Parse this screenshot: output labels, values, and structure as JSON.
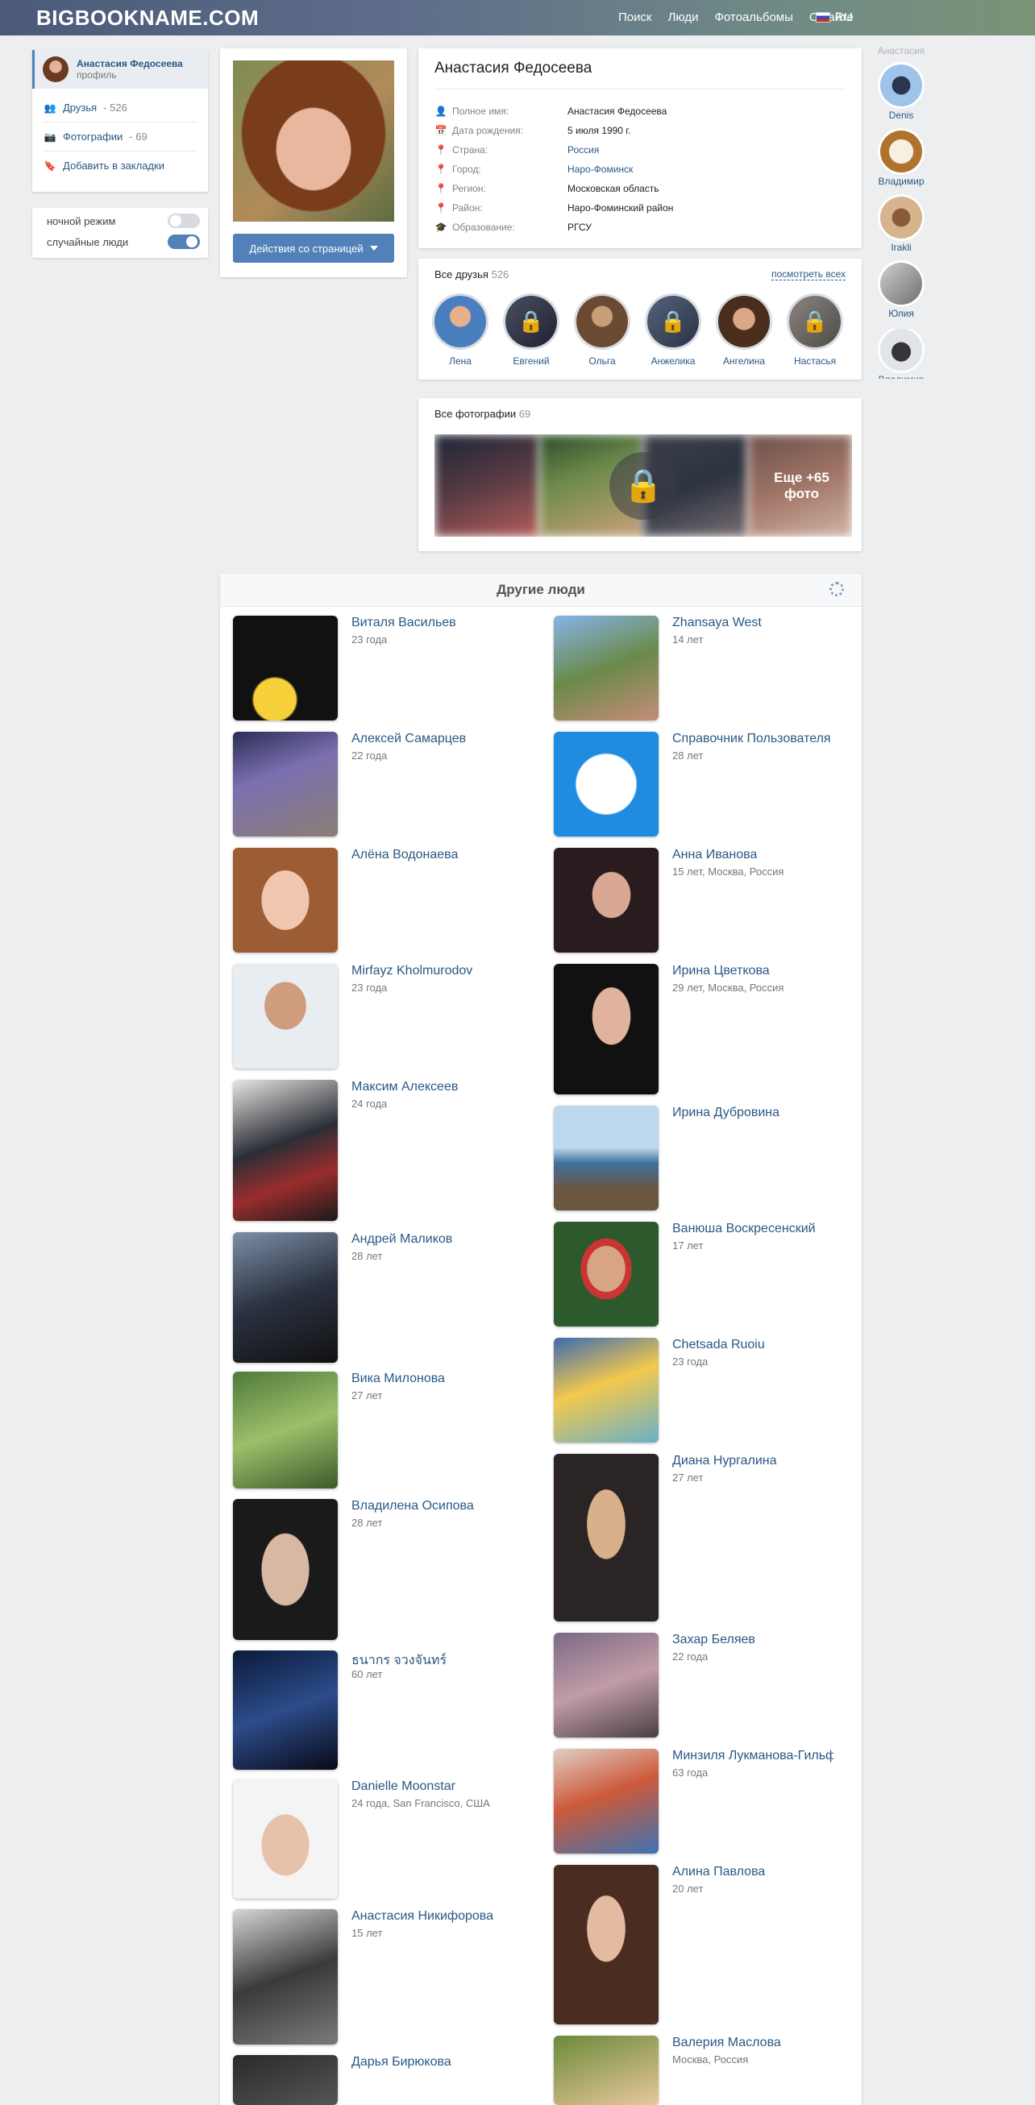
{
  "header": {
    "logo": "BIGBOOKNAME.COM",
    "nav": [
      "Поиск",
      "Люди",
      "Фотоальбомы",
      "О сайте"
    ],
    "lang": "RU"
  },
  "left_menu": {
    "profile_name": "Анастасия Федосеева",
    "profile_sub": "профиль",
    "friends_label": "Друзья",
    "friends_count": "- 526",
    "photos_label": "Фотографии",
    "photos_count": "- 69",
    "bookmark_label": "Добавить в закладки"
  },
  "toggles": {
    "night_mode": "ночной режим",
    "night_mode_on": false,
    "random_people": "случайные люди",
    "random_people_on": true
  },
  "profile": {
    "action_button": "Действия со страницей",
    "title": "Анастасия Федосеева",
    "rows": [
      {
        "label": "Полное имя:",
        "value": "Анастасия Федосеева",
        "icon": "user-icon"
      },
      {
        "label": "Дата рождения:",
        "value": "5 июля 1990 г.",
        "icon": "calendar-icon"
      },
      {
        "label": "Страна:",
        "value": "Россия",
        "icon": "location-icon"
      },
      {
        "label": "Город:",
        "value": "Наро-Фоминск",
        "icon": "location-icon"
      },
      {
        "label": "Регион:",
        "value": "Московская область",
        "icon": "location-icon"
      },
      {
        "label": "Район:",
        "value": "Наро-Фоминский район",
        "icon": "location-icon"
      },
      {
        "label": "Образование:",
        "value": "РГСУ",
        "icon": "education-icon"
      }
    ]
  },
  "friends": {
    "title": "Все друзья",
    "count": "526",
    "see_all": "посмотреть всех",
    "items": [
      {
        "name": "Лена",
        "locked": false
      },
      {
        "name": "Евгений",
        "locked": true
      },
      {
        "name": "Ольга",
        "locked": false
      },
      {
        "name": "Анжелика",
        "locked": true
      },
      {
        "name": "Ангелина",
        "locked": false
      },
      {
        "name": "Настасья",
        "locked": true
      }
    ]
  },
  "photos": {
    "title": "Все фотографии",
    "count": "69",
    "more_line1": "Еще +65",
    "more_line2": "фото"
  },
  "right_column": {
    "top_label": "Анастасия",
    "items": [
      "Denis",
      "Владимир",
      "Irakli",
      "Юлия",
      "Владимир"
    ]
  },
  "people": {
    "title": "Другие люди",
    "left": [
      {
        "name": "Виталя Васильев",
        "meta": "23 года"
      },
      {
        "name": "Алексей Самарцев",
        "meta": "22 года"
      },
      {
        "name": "Алёна Водонаева",
        "meta": ""
      },
      {
        "name": "Mirfayz Kholmurodov",
        "meta": "23 года"
      },
      {
        "name": "Максим Алексеев",
        "meta": "24 года"
      },
      {
        "name": "Андрей Маликов",
        "meta": "28 лет"
      },
      {
        "name": "Вика Милонова",
        "meta": "27 лет"
      },
      {
        "name": "Владилена Осипова",
        "meta": "28 лет"
      },
      {
        "name": "ธนากร จวงจันทร์",
        "meta": "60 лет"
      },
      {
        "name": "Danielle Moonstar",
        "meta": "24 года, San Francisco, США"
      },
      {
        "name": "Анастасия Никифорова",
        "meta": "15 лет"
      },
      {
        "name": "Дарья Бирюкова",
        "meta": ""
      }
    ],
    "right": [
      {
        "name": "Zhansaya West",
        "meta": "14 лет"
      },
      {
        "name": "Справочник Пользователя",
        "meta": "28 лет"
      },
      {
        "name": "Анна Иванова",
        "meta": "15 лет, Москва, Россия"
      },
      {
        "name": "Ирина Цветкова",
        "meta": "29 лет, Москва, Россия"
      },
      {
        "name": "Ирина Дубровина",
        "meta": ""
      },
      {
        "name": "Ванюша Воскресенский",
        "meta": "17 лет"
      },
      {
        "name": "Chetsada Ruoiu",
        "meta": "23 года"
      },
      {
        "name": "Диана Нургалина",
        "meta": "27 лет"
      },
      {
        "name": "Захар Беляев",
        "meta": "22 года"
      },
      {
        "name": "Минзиля Лукманова-Гильфанова",
        "meta": "63 года"
      },
      {
        "name": "Алина Павлова",
        "meta": "20 лет"
      },
      {
        "name": "Валерия Маслова",
        "meta": "Москва, Россия"
      }
    ]
  }
}
